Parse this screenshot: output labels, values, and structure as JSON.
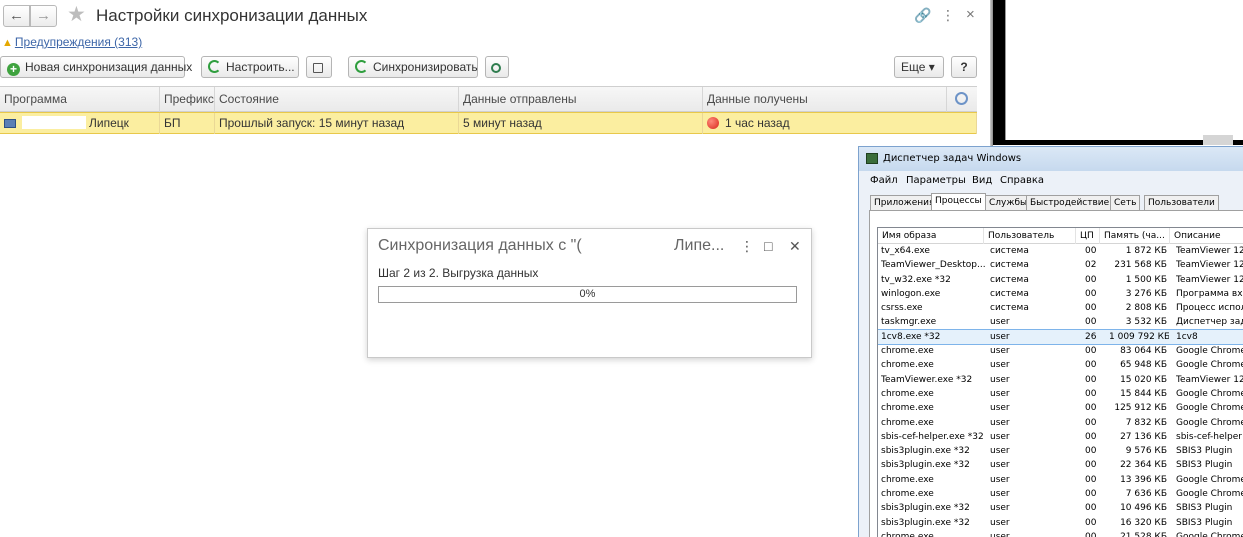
{
  "app": {
    "title": "Настройки синхронизации данных",
    "nav_back": "←",
    "nav_forward": "→",
    "link_icon": "🔗",
    "menu_icon": "⋮",
    "close_icon": "×"
  },
  "warning": {
    "icon": "▲",
    "label": "Предупреждения (313)"
  },
  "toolbar": {
    "new_sync_label": "Новая синхронизация данных",
    "configure_label": "Настроить...",
    "sync_label": "Синхронизировать",
    "more_label": "Еще ▾",
    "help_label": "?"
  },
  "table": {
    "columns": [
      "Программа",
      "Префикс",
      "Состояние",
      "Данные отправлены",
      "Данные получены"
    ],
    "rows": [
      {
        "program": "Липецк",
        "prefix": "БП",
        "state": "Прошлый запуск: 15 минут назад",
        "sent": "5 минут назад",
        "received": "1 час назад"
      }
    ]
  },
  "dialog": {
    "title_left": "Синхронизация данных с \"(",
    "title_right": "Липе...",
    "menu_icon": "⋮",
    "maximize_icon": "□",
    "close_icon": "✕",
    "step": "Шаг 2 из 2. Выгрузка данных",
    "progress_text": "0%",
    "progress_value": 0
  },
  "taskmgr": {
    "title": "Диспетчер задач Windows",
    "menu": [
      "Файл",
      "Параметры",
      "Вид",
      "Справка"
    ],
    "tabs": [
      "Приложения",
      "Процессы",
      "Службы",
      "Быстродействие",
      "Сеть",
      "Пользователи"
    ],
    "active_tab": 1,
    "columns": [
      "Имя образа",
      "Пользователь",
      "ЦП",
      "Память (ча...",
      "Описание"
    ],
    "processes": [
      {
        "name": "tv_x64.exe",
        "user": "система",
        "cpu": "00",
        "mem": "1 872 КБ",
        "desc": "TeamViewer 12"
      },
      {
        "name": "TeamViewer_Desktop....",
        "user": "система",
        "cpu": "02",
        "mem": "231 568 КБ",
        "desc": "TeamViewer 12"
      },
      {
        "name": "tv_w32.exe *32",
        "user": "система",
        "cpu": "00",
        "mem": "1 500 КБ",
        "desc": "TeamViewer 12"
      },
      {
        "name": "winlogon.exe",
        "user": "система",
        "cpu": "00",
        "mem": "3 276 КБ",
        "desc": "Программа вхо"
      },
      {
        "name": "csrss.exe",
        "user": "система",
        "cpu": "00",
        "mem": "2 808 КБ",
        "desc": "Процесс испол"
      },
      {
        "name": "taskmgr.exe",
        "user": "user",
        "cpu": "00",
        "mem": "3 532 КБ",
        "desc": "Диспетчер зад"
      },
      {
        "name": "1cv8.exe *32",
        "user": "user",
        "cpu": "26",
        "mem": "1 009 792 КБ",
        "desc": "1cv8"
      },
      {
        "name": "chrome.exe",
        "user": "user",
        "cpu": "00",
        "mem": "83 064 КБ",
        "desc": "Google Chrome"
      },
      {
        "name": "chrome.exe",
        "user": "user",
        "cpu": "00",
        "mem": "65 948 КБ",
        "desc": "Google Chrome"
      },
      {
        "name": "TeamViewer.exe *32",
        "user": "user",
        "cpu": "00",
        "mem": "15 020 КБ",
        "desc": "TeamViewer 12"
      },
      {
        "name": "chrome.exe",
        "user": "user",
        "cpu": "00",
        "mem": "15 844 КБ",
        "desc": "Google Chrome"
      },
      {
        "name": "chrome.exe",
        "user": "user",
        "cpu": "00",
        "mem": "125 912 КБ",
        "desc": "Google Chrome"
      },
      {
        "name": "chrome.exe",
        "user": "user",
        "cpu": "00",
        "mem": "7 832 КБ",
        "desc": "Google Chrome"
      },
      {
        "name": "sbis-cef-helper.exe *32",
        "user": "user",
        "cpu": "00",
        "mem": "27 136 КБ",
        "desc": "sbis-cef-helper"
      },
      {
        "name": "sbis3plugin.exe *32",
        "user": "user",
        "cpu": "00",
        "mem": "9 576 КБ",
        "desc": "SBIS3 Plugin"
      },
      {
        "name": "sbis3plugin.exe *32",
        "user": "user",
        "cpu": "00",
        "mem": "22 364 КБ",
        "desc": "SBIS3 Plugin"
      },
      {
        "name": "chrome.exe",
        "user": "user",
        "cpu": "00",
        "mem": "13 396 КБ",
        "desc": "Google Chrome"
      },
      {
        "name": "chrome.exe",
        "user": "user",
        "cpu": "00",
        "mem": "7 636 КБ",
        "desc": "Google Chrome"
      },
      {
        "name": "sbis3plugin.exe *32",
        "user": "user",
        "cpu": "00",
        "mem": "10 496 КБ",
        "desc": "SBIS3 Plugin"
      },
      {
        "name": "sbis3plugin.exe *32",
        "user": "user",
        "cpu": "00",
        "mem": "16 320 КБ",
        "desc": "SBIS3 Plugin"
      },
      {
        "name": "chrome.exe",
        "user": "user",
        "cpu": "00",
        "mem": "21 528 КБ",
        "desc": "Google Chrome"
      }
    ],
    "selected_index": 6
  }
}
